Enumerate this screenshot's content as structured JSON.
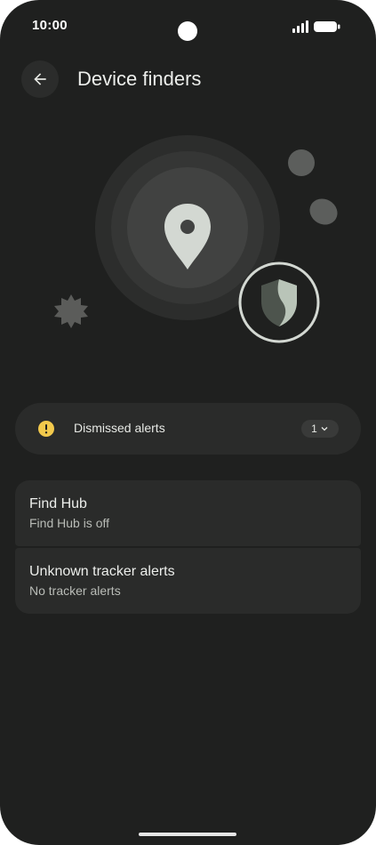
{
  "status_bar": {
    "time": "10:00"
  },
  "header": {
    "title": "Device finders"
  },
  "dismissed_alerts": {
    "label": "Dismissed alerts",
    "count": "1"
  },
  "settings": [
    {
      "title": "Find Hub",
      "subtitle": "Find Hub is off"
    },
    {
      "title": "Unknown tracker alerts",
      "subtitle": "No tracker alerts"
    }
  ],
  "colors": {
    "background": "#1f201f",
    "card": "#2a2b2a",
    "warning": "#f2c94c",
    "accent": "#b9c4b8"
  },
  "icons": [
    "back-arrow-icon",
    "location-pin-icon",
    "shield-icon",
    "warning-icon",
    "chevron-down-icon",
    "signal-icon",
    "battery-icon"
  ]
}
